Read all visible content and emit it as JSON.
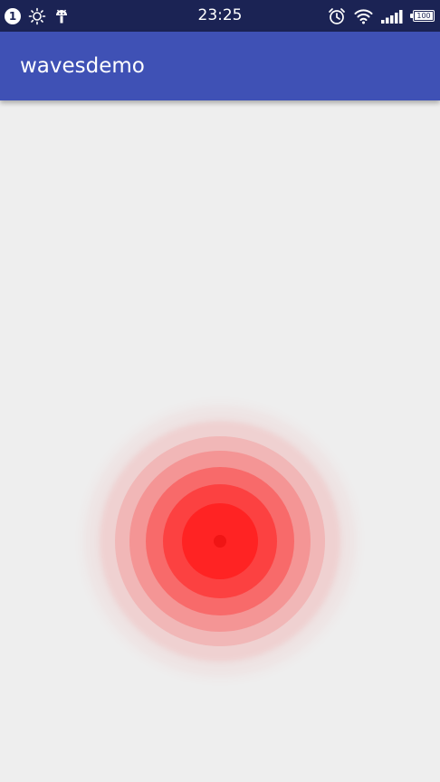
{
  "statusbar": {
    "notification_count": "1",
    "time": "23:25",
    "battery_level": "100",
    "icons": [
      "brightness-icon",
      "android-debug-icon",
      "alarm-icon",
      "wifi-icon",
      "signal-icon",
      "battery-icon"
    ]
  },
  "appbar": {
    "title": "wavesdemo"
  },
  "waves": {
    "color": "#ff1f1f",
    "background": "#eeeeee",
    "ring_count": 7
  }
}
